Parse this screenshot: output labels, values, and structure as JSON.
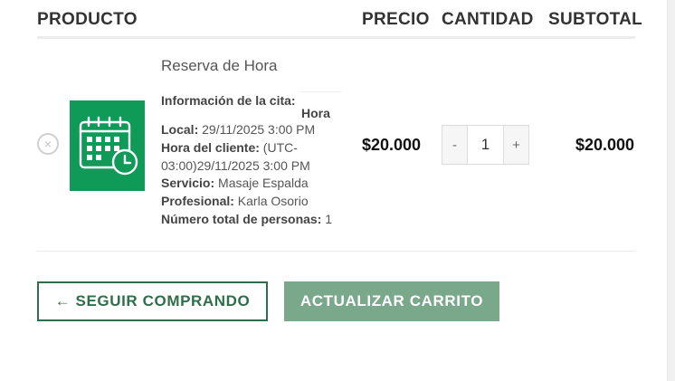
{
  "table": {
    "headers": {
      "product": "PRODUCTO",
      "price": "PRECIO",
      "quantity": "CANTIDAD",
      "subtotal": "SUBTOTAL"
    }
  },
  "item": {
    "remove_symbol": "×",
    "thumbnail_icon": "calendar-clock-icon",
    "name": "Reserva de Hora",
    "info_label": "Información de la cita:",
    "info_value": "Hora",
    "local_label": "Local:",
    "local_value": " 29/11/2025 3:00 PM",
    "client_time_label": "Hora del cliente:",
    "client_time_value_1": " (UTC-",
    "client_time_value_2": "03:00)29/11/2025 3:00 PM",
    "service_label": "Servicio:",
    "service_value": " Masaje Espalda",
    "professional_label": "Profesional:",
    "professional_value": " Karla Osorio",
    "persons_label": "Número total de personas:",
    "persons_value": " 1",
    "price": "$20.000",
    "quantity": "1",
    "qty_minus": "-",
    "qty_plus": "+",
    "subtotal": "$20.000"
  },
  "actions": {
    "continue_shopping": "← SEGUIR COMPRANDO",
    "update_cart": "ACTUALIZAR CARRITO"
  },
  "colors": {
    "thumbnail_bg": "#0f9a58",
    "outline_button": "#2f6e4a",
    "update_button": "#7aa88b"
  }
}
